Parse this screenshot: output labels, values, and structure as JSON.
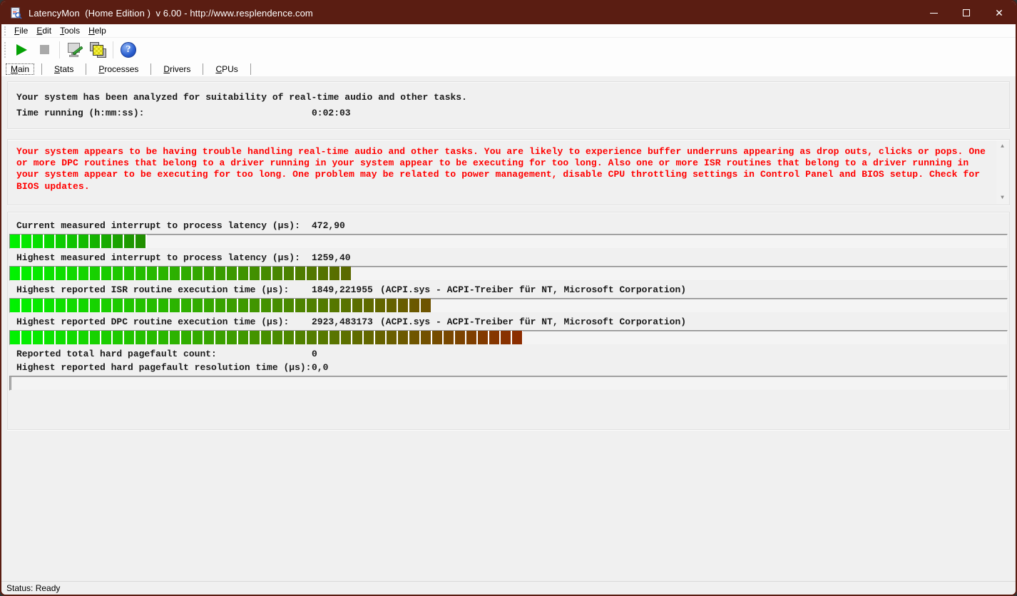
{
  "window": {
    "title": "LatencyMon  (Home Edition )  v 6.00 - http://www.resplendence.com"
  },
  "colors": {
    "titlebar": "#5a1d12",
    "warning_text": "#ff0000",
    "bar_start": "#00f300"
  },
  "menu": {
    "items": [
      "File",
      "Edit",
      "Tools",
      "Help"
    ]
  },
  "toolbar": {
    "icons": [
      "play-icon",
      "stop-icon",
      "analyze-monitor-icon",
      "processes-windows-icon",
      "help-icon"
    ]
  },
  "tabs": {
    "selected": "Main",
    "items": [
      {
        "label": "Main"
      },
      {
        "label": "Stats"
      },
      {
        "label": "Processes"
      },
      {
        "label": "Drivers"
      },
      {
        "label": "CPUs"
      }
    ]
  },
  "report": {
    "analysis_line": "Your system has been analyzed for suitability of real-time audio and other tasks.",
    "time_label": "Time running (h:mm:ss):",
    "time_value": "0:02:03"
  },
  "warning": {
    "text": "Your system appears to be having trouble handling real-time audio and other tasks. You are likely to experience buffer underruns appearing as drop outs, clicks or pops. One or more DPC routines that belong to a driver running in your system appear to be executing for too long. Also one or more ISR routines that belong to a driver running in your system appear to be executing for too long. One problem may be related to power management, disable CPU throttling settings in Control Panel and BIOS setup. Check for BIOS updates."
  },
  "stats": {
    "rows": [
      {
        "label": "Current measured interrupt to process latency (µs):",
        "value": "472,90",
        "extra": "",
        "bar": {
          "percent": 13.7,
          "end_color": "#218c00"
        }
      },
      {
        "label": "Highest measured interrupt to process latency (µs):",
        "value": "1259,40",
        "extra": "",
        "bar": {
          "percent": 34.2,
          "end_color": "#5c6800"
        }
      },
      {
        "label": "Highest reported ISR routine execution time (µs):",
        "value": "1849,221955",
        "extra": "(ACPI.sys - ACPI-Treiber für NT, Microsoft Corporation)",
        "bar": {
          "percent": 42.2,
          "end_color": "#6f5200"
        }
      },
      {
        "label": "Highest reported DPC routine execution time (µs):",
        "value": "2923,483173",
        "extra": "(ACPI.sys - ACPI-Treiber für NT, Microsoft Corporation)",
        "bar": {
          "percent": 51.4,
          "end_color": "#8d2b00"
        }
      }
    ],
    "pagefault_rows": [
      {
        "label": "Reported total hard pagefault count:",
        "value": "0"
      },
      {
        "label": "Highest reported hard pagefault resolution time (µs):",
        "value": "0,0"
      }
    ]
  },
  "statusbar": {
    "text": "Status: Ready"
  }
}
